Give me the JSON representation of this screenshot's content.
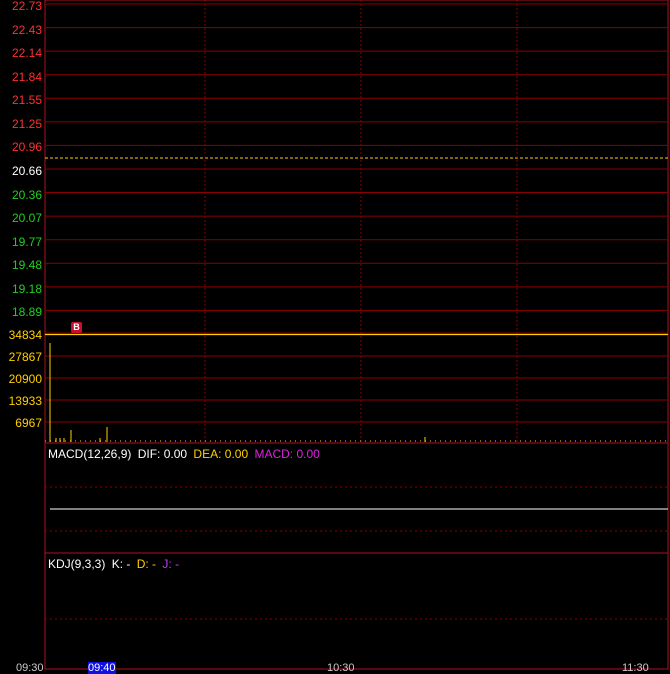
{
  "price_axis": {
    "labels": [
      {
        "text": "22.73",
        "color": "#ff3030"
      },
      {
        "text": "22.43",
        "color": "#ff3030"
      },
      {
        "text": "22.14",
        "color": "#ff3030"
      },
      {
        "text": "21.84",
        "color": "#ff3030"
      },
      {
        "text": "21.55",
        "color": "#ff3030"
      },
      {
        "text": "21.25",
        "color": "#ff3030"
      },
      {
        "text": "20.96",
        "color": "#ff3030"
      },
      {
        "text": "20.66",
        "color": "#ffffff"
      },
      {
        "text": "20.36",
        "color": "#20d020"
      },
      {
        "text": "20.07",
        "color": "#20d020"
      },
      {
        "text": "19.77",
        "color": "#20d020"
      },
      {
        "text": "19.48",
        "color": "#20d020"
      },
      {
        "text": "19.18",
        "color": "#20d020"
      },
      {
        "text": "18.89",
        "color": "#20d020"
      }
    ],
    "prev_close": "20.66"
  },
  "volume_axis": {
    "labels": [
      "34834",
      "27867",
      "20900",
      "13933",
      "6967"
    ],
    "color": "#ffd000"
  },
  "trade_marker": {
    "label": "B"
  },
  "macd": {
    "title": "MACD(12,26,9)",
    "dif_label": "DIF: 0.00",
    "dea_label": "DEA: 0.00",
    "macd_label": "MACD: 0.00"
  },
  "kdj": {
    "title": "KDJ(9,3,3)",
    "k_label": "K: -",
    "d_label": "D: -",
    "j_label": "J: -"
  },
  "x_axis": {
    "labels": [
      "09:30",
      "09:40",
      "10:30",
      "11:30"
    ]
  },
  "colors": {
    "grid": "#8b0000",
    "frame": "#b01020",
    "up": "#ff3030",
    "down": "#20d020",
    "volume": "#ffd000",
    "dea": "#ffd000",
    "macd": "#e020e0",
    "j": "#c040ff"
  }
}
